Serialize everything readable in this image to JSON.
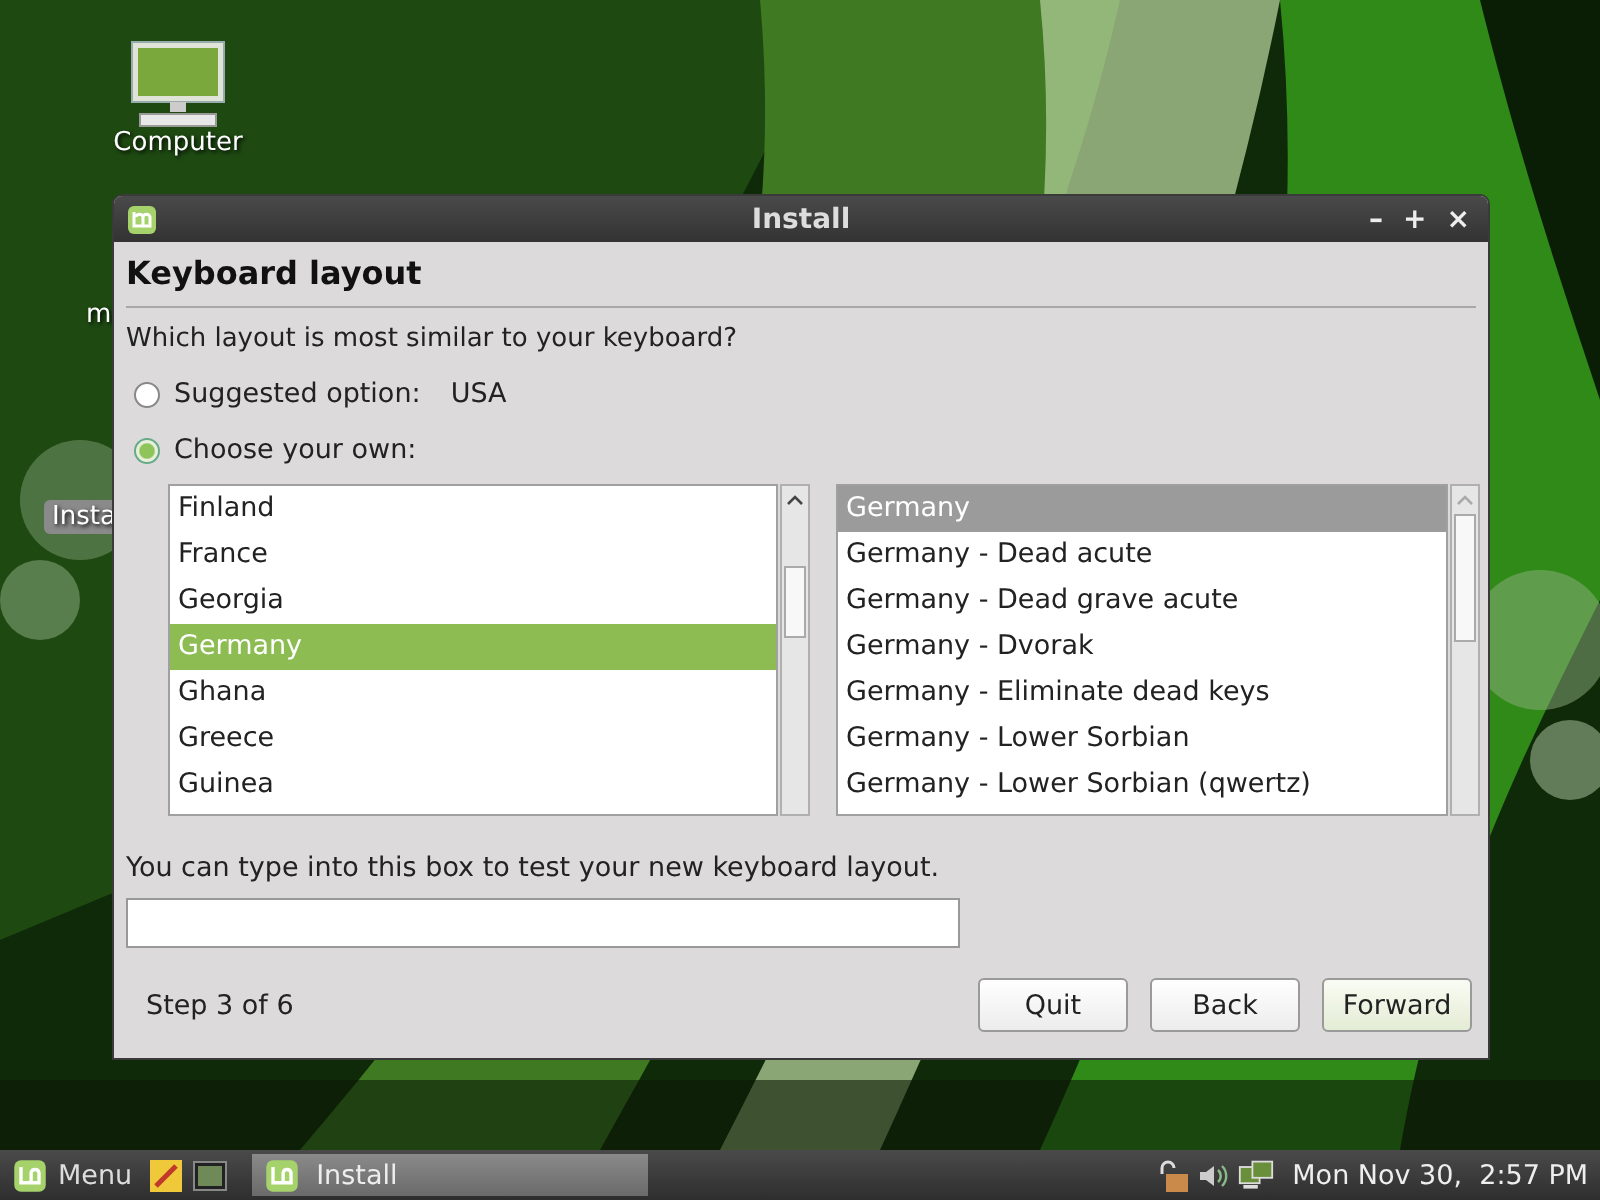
{
  "desktop": {
    "icons": [
      {
        "label": "Computer"
      }
    ],
    "partial_labels": [
      "m",
      "Insta"
    ]
  },
  "window": {
    "title": "Install",
    "controls": [
      "–",
      "+",
      "×"
    ]
  },
  "page": {
    "heading": "Keyboard layout",
    "question": "Which layout is most similar to your keyboard?"
  },
  "options": [
    {
      "label": "Suggested option:",
      "value": "USA",
      "selected": false
    },
    {
      "label": "Choose your own:",
      "selected": true
    }
  ],
  "countries": [
    {
      "label": "Finland",
      "selected": false
    },
    {
      "label": "France",
      "selected": false
    },
    {
      "label": "Georgia",
      "selected": false
    },
    {
      "label": "Germany",
      "selected": true
    },
    {
      "label": "Ghana",
      "selected": false
    },
    {
      "label": "Greece",
      "selected": false
    },
    {
      "label": "Guinea",
      "selected": false
    }
  ],
  "variants": [
    {
      "label": "Germany",
      "selected": true
    },
    {
      "label": "Germany - Dead acute",
      "selected": false
    },
    {
      "label": "Germany - Dead grave acute",
      "selected": false
    },
    {
      "label": "Germany - Dvorak",
      "selected": false
    },
    {
      "label": "Germany - Eliminate dead keys",
      "selected": false
    },
    {
      "label": "Germany - Lower Sorbian",
      "selected": false
    },
    {
      "label": "Germany - Lower Sorbian (qwertz)",
      "selected": false
    }
  ],
  "test_field": {
    "label": "You can type into this box to test your new keyboard layout."
  },
  "footer": {
    "step": "Step 3 of 6",
    "buttons": [
      "Quit",
      "Back",
      "Forward"
    ]
  },
  "taskbar": {
    "menu": "Menu",
    "tasks": [
      {
        "label": "Install"
      }
    ],
    "clock": "Mon Nov 30,  2:57 PM"
  }
}
